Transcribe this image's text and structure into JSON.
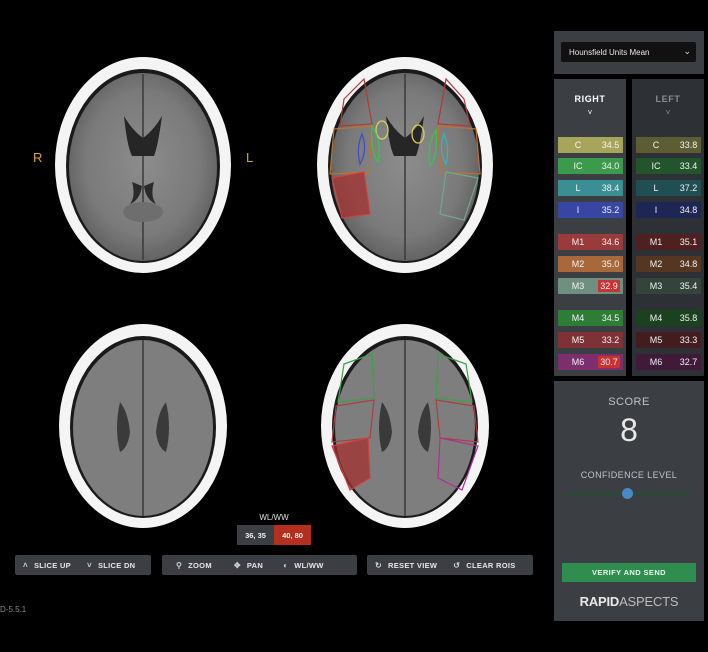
{
  "side_labels": {
    "right": "R",
    "left": "L"
  },
  "toolbar": {
    "slice_up": "SLICE UP",
    "slice_dn": "SLICE DN",
    "zoom": "ZOOM",
    "pan": "PAN",
    "wlww": "WL/WW",
    "reset_view": "RESET VIEW",
    "clear_rois": "CLEAR ROIS"
  },
  "window_level": {
    "title": "WL/WW",
    "preset_a": "36, 35",
    "preset_b": "40, 80",
    "preset_a_color": "#3b3f44",
    "preset_b_color": "#b3301f"
  },
  "version": "D-5.5.1",
  "measure_select": {
    "value": "Hounsfield Units Mean"
  },
  "columns": {
    "right": "RIGHT",
    "left": "LEFT"
  },
  "regions": [
    {
      "label": "C",
      "right": "34.5",
      "left": "33.8",
      "right_color": "#a7a55a",
      "left_color": "#5e5c32",
      "right_flag": false
    },
    {
      "label": "IC",
      "right": "34.0",
      "left": "33.4",
      "right_color": "#3c9a4c",
      "left_color": "#23552c",
      "right_flag": false
    },
    {
      "label": "L",
      "right": "38.4",
      "left": "37.2",
      "right_color": "#3a8f94",
      "left_color": "#1f4f52",
      "right_flag": false
    },
    {
      "label": "I",
      "right": "35.2",
      "left": "34.8",
      "right_color": "#3646a2",
      "left_color": "#1d2655",
      "right_flag": false
    },
    {
      "label": "M1",
      "right": "34.6",
      "left": "35.1",
      "right_color": "#9a3a3a",
      "left_color": "#4e2020",
      "right_flag": false
    },
    {
      "label": "M2",
      "right": "35.0",
      "left": "34.8",
      "right_color": "#a9683a",
      "left_color": "#553620",
      "right_flag": false
    },
    {
      "label": "M3",
      "right": "32.9",
      "left": "35.4",
      "right_color": "#6f907e",
      "left_color": "#34443b",
      "right_flag": true
    },
    {
      "label": "M4",
      "right": "34.5",
      "left": "35.8",
      "right_color": "#2e7d37",
      "left_color": "#1b421f",
      "right_flag": false
    },
    {
      "label": "M5",
      "right": "33.2",
      "left": "33.3",
      "right_color": "#7f3236",
      "left_color": "#431c1f",
      "right_flag": false
    },
    {
      "label": "M6",
      "right": "30.7",
      "left": "32.7",
      "right_color": "#7c2f6e",
      "left_color": "#3f1a39",
      "right_flag": true
    }
  ],
  "score": {
    "title": "SCORE",
    "value": "8"
  },
  "confidence": {
    "title": "CONFIDENCE LEVEL",
    "level": 0.5
  },
  "verify_button": "VERIFY AND SEND",
  "brand": {
    "part1": "RAPID",
    "part2": "ASPECTS"
  }
}
